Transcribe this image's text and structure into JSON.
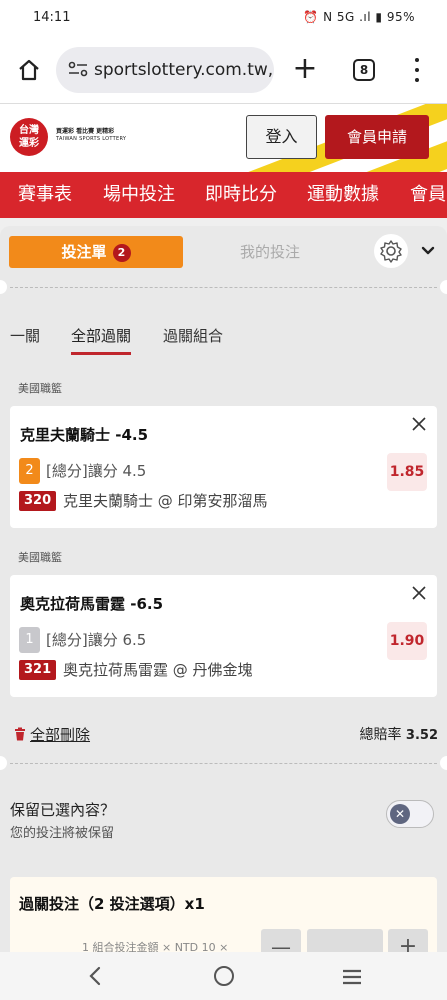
{
  "status_bar": {
    "time": "14:11",
    "indicators": "⏰ N 5G .ıl ▮ 95%"
  },
  "browser": {
    "url": "sportslottery.com.tw,",
    "tab_count": "8"
  },
  "site": {
    "logo_text": "台灣\n運彩",
    "slogan": "買運彩 看比賽 更精彩",
    "slogan_en": "TAIWAN SPORTS LOTTERY",
    "login": "登入",
    "register": "會員申請"
  },
  "nav": [
    "賽事表",
    "場中投注",
    "即時比分",
    "運動數據",
    "會員"
  ],
  "slip": {
    "tab_betslip": "投注單",
    "betslip_count": "2",
    "tab_mybets": "我的投注",
    "subtabs": [
      "一關",
      "全部過關",
      "過關組合"
    ],
    "bets": [
      {
        "league": "美國職籃",
        "title": "克里夫蘭騎士 -4.5",
        "num": "2",
        "market": "[總分]讓分 4.5",
        "code": "320",
        "match": "克里夫蘭騎士 @ 印第安那溜馬",
        "odds": "1.85"
      },
      {
        "league": "美國職籃",
        "title": "奧克拉荷馬雷霆 -6.5",
        "num": "1",
        "market": "[總分]讓分 6.5",
        "code": "321",
        "match": "奧克拉荷馬雷霆 @ 丹佛金塊",
        "odds": "1.90"
      }
    ],
    "delete_all": "全部刪除",
    "total_odds_label": "總賠率",
    "total_odds": "3.52",
    "keep_title": "保留已選內容？",
    "keep_sub": "您的投注將被保留",
    "parlay_title": "過關投注（2 投注選項）x1",
    "parlay_note": "1 組合投注金額 × NTD 10 ×",
    "minus": "—",
    "plus": "+"
  },
  "colors": {
    "brand_red": "#d8262c",
    "dark_red": "#b3181d",
    "orange": "#f28a1a",
    "yellow": "#f5d11e"
  },
  "icons": [
    "home-icon",
    "tune-icon",
    "plus-icon",
    "tabs-icon",
    "kebab-icon",
    "gear-icon",
    "chevron-down-icon",
    "close-icon",
    "trash-icon",
    "toggle-off-icon",
    "back-icon",
    "home-circle-icon",
    "recents-icon"
  ]
}
